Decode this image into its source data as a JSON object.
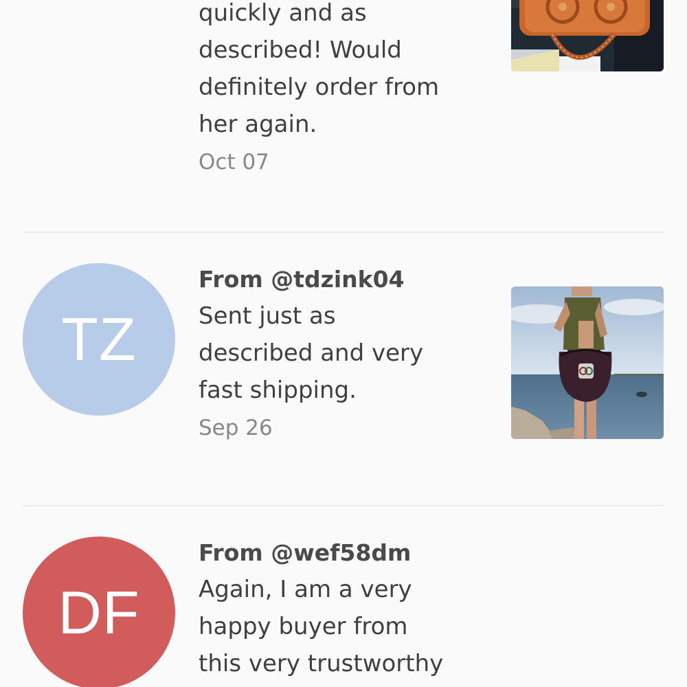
{
  "reviews": [
    {
      "body_lines": [
        "quickly and as",
        "described! Would",
        "definitely order from",
        "her again."
      ],
      "date": "Oct 07",
      "photo": "orange-leather-handbag-photo"
    },
    {
      "from": "From @tdzink04",
      "initials": "TZ",
      "avatar_color": "#b7cce8",
      "body_lines": [
        "Sent just as",
        "described and very",
        "fast shipping."
      ],
      "date": "Sep 26",
      "photo": "woman-with-gucci-bag-by-sea-photo"
    },
    {
      "from": "From @wef58dm",
      "initials": "DF",
      "avatar_color": "#d25b5b",
      "body_lines": [
        "Again, I am a very",
        "happy buyer from",
        "this very trustworthy"
      ]
    }
  ]
}
